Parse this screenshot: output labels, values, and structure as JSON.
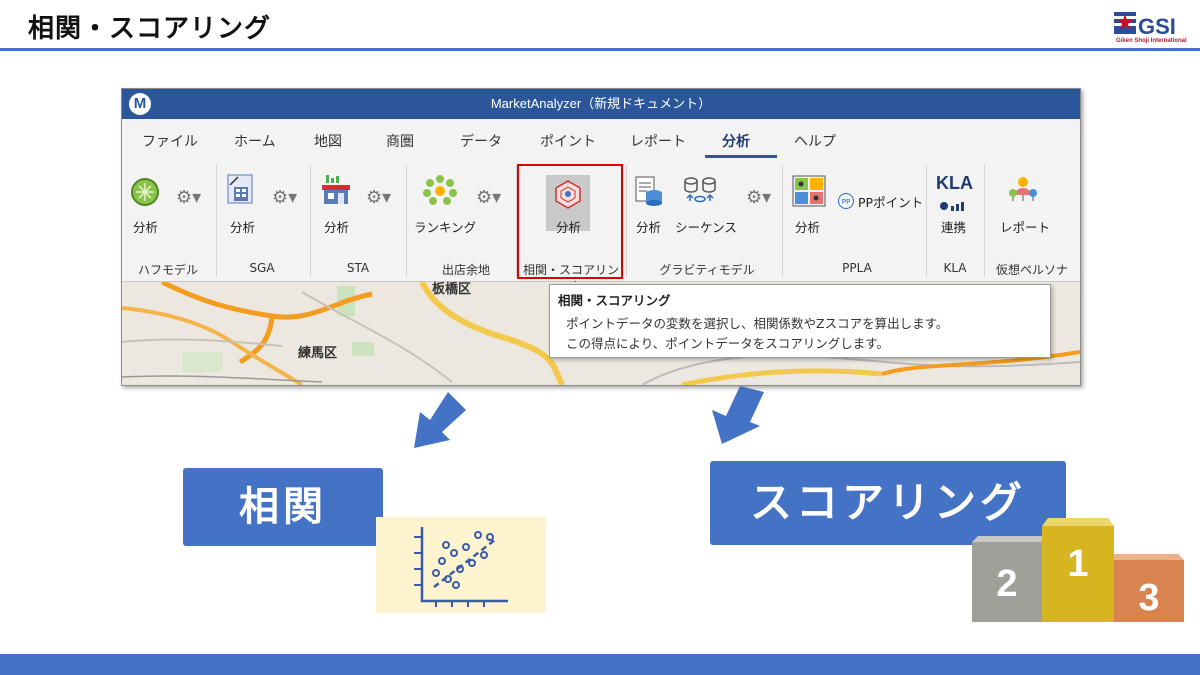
{
  "slide": {
    "title": "相関・スコアリング",
    "logo_text": "Giken Shoji International",
    "logo_mark": "GSI"
  },
  "app": {
    "window_title": "MarketAnalyzer（新規ドキュメント）",
    "app_icon": "M",
    "menu_tabs": [
      "ファイル",
      "ホーム",
      "地図",
      "商圏",
      "データ",
      "ポイント",
      "レポート",
      "分析",
      "ヘルプ"
    ],
    "active_tab": "分析",
    "ribbon_groups": [
      {
        "name": "ハフモデル",
        "buttons": [
          "分析"
        ]
      },
      {
        "name": "SGA",
        "buttons": [
          "分析"
        ]
      },
      {
        "name": "STA",
        "buttons": [
          "分析"
        ]
      },
      {
        "name": "出店余地",
        "buttons": [
          "ランキング"
        ]
      },
      {
        "name": "相関・スコアリング",
        "buttons": [
          "分析"
        ]
      },
      {
        "name": "グラビティモデル",
        "buttons": [
          "分析",
          "シーケンス"
        ]
      },
      {
        "name": "PPLA",
        "buttons": [
          "分析",
          "PPポイント"
        ]
      },
      {
        "name": "KLA",
        "buttons": [
          "連携"
        ]
      },
      {
        "name": "仮想ペルソナ",
        "buttons": [
          "レポート"
        ]
      }
    ],
    "kla_icon_text": "KLA",
    "pp_badge": "PP",
    "tooltip": {
      "title": "相関・スコアリング",
      "line1": "ポイントデータの変数を選択し、相関係数やZスコアを算出します。",
      "line2": "この得点により、ポイントデータをスコアリングします。"
    },
    "map_labels": [
      "板橋区",
      "練馬区"
    ]
  },
  "concepts": {
    "correlation_label": "相関",
    "scoring_label": "スコアリング"
  },
  "podium": {
    "first": "1",
    "second": "2",
    "third": "3"
  },
  "colors": {
    "accent": "#4472c4",
    "titlebar": "#2b579a",
    "highlight": "#e00000",
    "podium_first": "#d6b520",
    "podium_second": "#9ea09a",
    "podium_third": "#d9834e"
  }
}
